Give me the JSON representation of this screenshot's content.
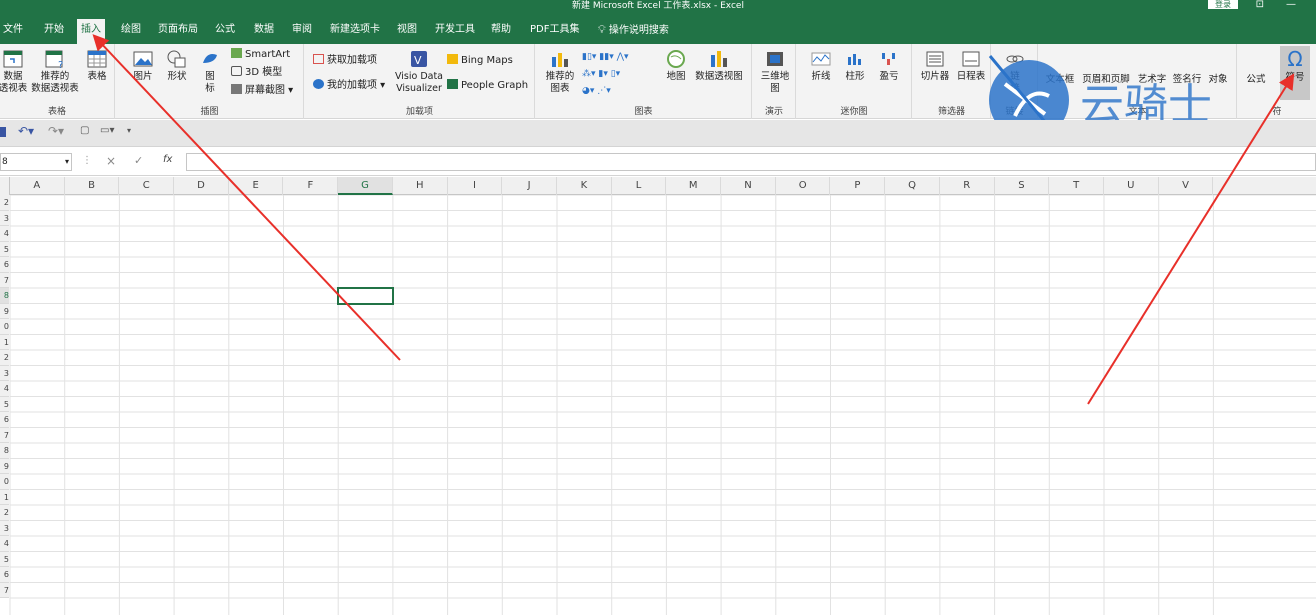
{
  "window": {
    "title": "新建 Microsoft Excel 工作表.xlsx  -  Excel",
    "login_label": "登录"
  },
  "tabs": [
    {
      "label": "文件",
      "active": false
    },
    {
      "label": "开始",
      "active": false
    },
    {
      "label": "插入",
      "active": true
    },
    {
      "label": "绘图",
      "active": false
    },
    {
      "label": "页面布局",
      "active": false
    },
    {
      "label": "公式",
      "active": false
    },
    {
      "label": "数据",
      "active": false
    },
    {
      "label": "审阅",
      "active": false
    },
    {
      "label": "新建选项卡",
      "active": false
    },
    {
      "label": "视图",
      "active": false
    },
    {
      "label": "开发工具",
      "active": false
    },
    {
      "label": "帮助",
      "active": false
    },
    {
      "label": "PDF工具集",
      "active": false
    },
    {
      "label": "操作说明搜索",
      "active": false
    }
  ],
  "ribbon": {
    "tables": {
      "group_label": "表格",
      "pivot_l1": "数据",
      "pivot_l2": "透视表",
      "rec_pivot_l1": "推荐的",
      "rec_pivot_l2": "数据透视表",
      "table": "表格"
    },
    "illustrations": {
      "group_label": "插图",
      "picture": "图片",
      "shapes": "形状",
      "icons_l1": "图",
      "icons_l2": "标",
      "smartart": "SmartArt",
      "model3d": "3D 模型",
      "screenshot": "屏幕截图"
    },
    "addins": {
      "group_label": "加载项",
      "get_addins": "获取加载项",
      "my_addins": "我的加载项",
      "visio_l1": "Visio Data",
      "visio_l2": "Visualizer",
      "bing_maps": "Bing Maps",
      "people_graph": "People Graph"
    },
    "charts": {
      "group_label": "图表",
      "rec_charts_l1": "推荐的",
      "rec_charts_l2": "图表",
      "maps": "地图",
      "pivot_chart": "数据透视图"
    },
    "tours": {
      "group_label": "演示",
      "map3d_l1": "三维地",
      "map3d_l2": "图"
    },
    "sparklines": {
      "group_label": "迷你图",
      "line": "折线",
      "column": "柱形",
      "winloss": "盈亏"
    },
    "filters": {
      "group_label": "筛选器",
      "slicer": "切片器",
      "timeline": "日程表"
    },
    "links": {
      "group_label": "链接",
      "link_l1": "链",
      "link_l2": "接"
    },
    "text": {
      "group_label": "文本",
      "textbox": "文本框",
      "header_footer": "页眉和页脚",
      "wordart": "艺术字",
      "signature": "签名行",
      "object": "对象"
    },
    "symbols": {
      "group_label": "符",
      "equation": "公式",
      "symbol": "符号"
    }
  },
  "formula_bar": {
    "name_box": "8",
    "cancel": "×",
    "enter": "✓",
    "fx": "fx"
  },
  "sheet": {
    "columns": [
      "A",
      "B",
      "C",
      "D",
      "E",
      "F",
      "G",
      "H",
      "I",
      "J",
      "K",
      "L",
      "M",
      "N",
      "O",
      "P",
      "Q",
      "R",
      "S",
      "T",
      "U",
      "V"
    ],
    "selected_column": "G",
    "selected_row_index": 6,
    "rows": [
      "2",
      "3",
      "4",
      "5",
      "6",
      "7",
      "8",
      "9",
      "0",
      "1",
      "2",
      "3",
      "4",
      "5",
      "6",
      "7",
      "8",
      "9",
      "0",
      "1",
      "2",
      "3",
      "4",
      "5",
      "6",
      "7"
    ]
  },
  "watermark": {
    "text": "云骑士"
  },
  "colors": {
    "accent": "#217346",
    "arrow": "#e8302a"
  }
}
